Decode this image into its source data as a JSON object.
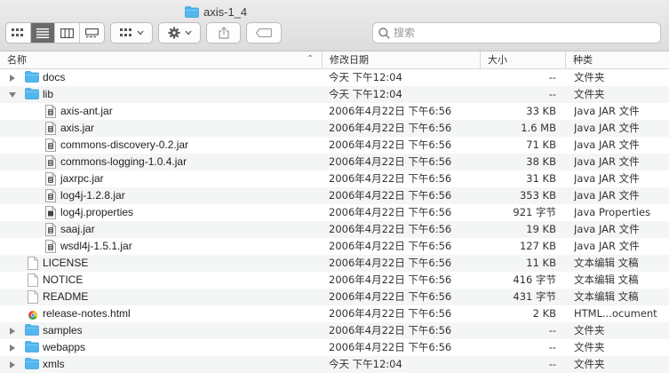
{
  "window": {
    "title": "axis-1_4"
  },
  "toolbar": {
    "search_placeholder": "搜索",
    "view_buttons": [
      "icon-view-icon",
      "list-view-icon",
      "column-view-icon",
      "gallery-view-icon"
    ]
  },
  "columns": {
    "name": "名称",
    "date": "修改日期",
    "size": "大小",
    "kind": "种类"
  },
  "colors": {
    "folder": "#52b6ef",
    "selected_view": "#6b6b6b"
  },
  "files": [
    {
      "name": "docs",
      "date": "今天 下午12:04",
      "size": "--",
      "kind": "文件夹",
      "type": "folder",
      "depth": 0,
      "disclosure": "closed"
    },
    {
      "name": "lib",
      "date": "今天 下午12:04",
      "size": "--",
      "kind": "文件夹",
      "type": "folder",
      "depth": 0,
      "disclosure": "open"
    },
    {
      "name": "axis-ant.jar",
      "date": "2006年4月22日 下午6:56",
      "size": "33 KB",
      "kind": "Java JAR 文件",
      "type": "jar",
      "depth": 1
    },
    {
      "name": "axis.jar",
      "date": "2006年4月22日 下午6:56",
      "size": "1.6 MB",
      "kind": "Java JAR 文件",
      "type": "jar",
      "depth": 1
    },
    {
      "name": "commons-discovery-0.2.jar",
      "date": "2006年4月22日 下午6:56",
      "size": "71 KB",
      "kind": "Java JAR 文件",
      "type": "jar",
      "depth": 1
    },
    {
      "name": "commons-logging-1.0.4.jar",
      "date": "2006年4月22日 下午6:56",
      "size": "38 KB",
      "kind": "Java JAR 文件",
      "type": "jar",
      "depth": 1
    },
    {
      "name": "jaxrpc.jar",
      "date": "2006年4月22日 下午6:56",
      "size": "31 KB",
      "kind": "Java JAR 文件",
      "type": "jar",
      "depth": 1
    },
    {
      "name": "log4j-1.2.8.jar",
      "date": "2006年4月22日 下午6:56",
      "size": "353 KB",
      "kind": "Java JAR 文件",
      "type": "jar",
      "depth": 1
    },
    {
      "name": "log4j.properties",
      "date": "2006年4月22日 下午6:56",
      "size": "921 字节",
      "kind": "Java Properties",
      "type": "props",
      "depth": 1
    },
    {
      "name": "saaj.jar",
      "date": "2006年4月22日 下午6:56",
      "size": "19 KB",
      "kind": "Java JAR 文件",
      "type": "jar",
      "depth": 1
    },
    {
      "name": "wsdl4j-1.5.1.jar",
      "date": "2006年4月22日 下午6:56",
      "size": "127 KB",
      "kind": "Java JAR 文件",
      "type": "jar",
      "depth": 1
    },
    {
      "name": "LICENSE",
      "date": "2006年4月22日 下午6:56",
      "size": "11 KB",
      "kind": "文本编辑 文稿",
      "type": "doc",
      "depth": 0
    },
    {
      "name": "NOTICE",
      "date": "2006年4月22日 下午6:56",
      "size": "416 字节",
      "kind": "文本编辑 文稿",
      "type": "doc",
      "depth": 0
    },
    {
      "name": "README",
      "date": "2006年4月22日 下午6:56",
      "size": "431 字节",
      "kind": "文本编辑 文稿",
      "type": "doc",
      "depth": 0
    },
    {
      "name": "release-notes.html",
      "date": "2006年4月22日 下午6:56",
      "size": "2 KB",
      "kind": "HTML...ocument",
      "type": "html",
      "depth": 0
    },
    {
      "name": "samples",
      "date": "2006年4月22日 下午6:56",
      "size": "--",
      "kind": "文件夹",
      "type": "folder",
      "depth": 0,
      "disclosure": "closed"
    },
    {
      "name": "webapps",
      "date": "2006年4月22日 下午6:56",
      "size": "--",
      "kind": "文件夹",
      "type": "folder",
      "depth": 0,
      "disclosure": "closed"
    },
    {
      "name": "xmls",
      "date": "今天 下午12:04",
      "size": "--",
      "kind": "文件夹",
      "type": "folder",
      "depth": 0,
      "disclosure": "closed"
    }
  ]
}
